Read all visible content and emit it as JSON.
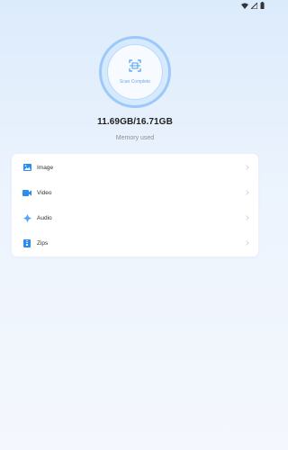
{
  "status_bar": {
    "icons": [
      "wifi-icon",
      "signal-icon",
      "battery-icon"
    ]
  },
  "scan": {
    "status": "Scan Complete",
    "icon": "scan-icon",
    "accent_color": "#4a9cf2"
  },
  "memory": {
    "value": "11.69GB/16.71GB",
    "label": "Memory used"
  },
  "categories": [
    {
      "label": "Image",
      "icon": "image-icon"
    },
    {
      "label": "Video",
      "icon": "video-icon"
    },
    {
      "label": "Audio",
      "icon": "audio-icon"
    },
    {
      "label": "Zips",
      "icon": "zip-icon"
    }
  ]
}
